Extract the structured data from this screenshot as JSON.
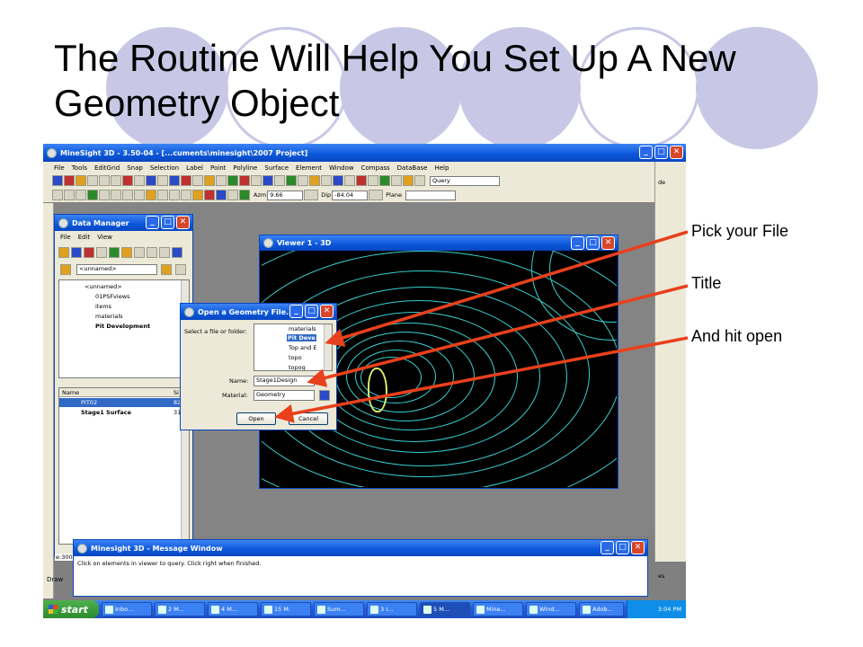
{
  "slide": {
    "title": "The Routine Will Help You Set Up A New Geometry Object",
    "callouts": [
      "Pick your File",
      "Title",
      "And hit open"
    ]
  },
  "app": {
    "title": "MineSight 3D  - 3.50-04 - [...cuments\\minesight\\2007 Project]",
    "menu": [
      "File",
      "Tools",
      "EditGrid",
      "Snap",
      "Selection",
      "Label",
      "Point",
      "Polyline",
      "Surface",
      "Element",
      "Window",
      "Compass",
      "DataBase",
      "Help"
    ],
    "query_label": "Query",
    "azm_label": "Azm",
    "azm_value": "9.66",
    "dip_label": "Dip",
    "dip_value": "-84.04",
    "plane_label": "Plane",
    "side_text": "de",
    "side_text2": "es",
    "draw_label": "Draw"
  },
  "data_manager": {
    "title": "Data Manager",
    "menu": [
      "File",
      "Edit",
      "View"
    ],
    "combo_value": "<unnamed>",
    "tree": [
      "<unnamed>",
      "01PSFviews",
      "items",
      "materials",
      "Pit Development"
    ],
    "columns": [
      "Name",
      "Si"
    ],
    "rows": [
      {
        "name": "PIT02",
        "size": "82"
      },
      {
        "name": "Stage1 Surface",
        "size": "31"
      }
    ],
    "side_text": "e:300"
  },
  "viewer": {
    "title": "Viewer 1 - 3D"
  },
  "dialog": {
    "title": "Open a Geometry File...",
    "select_label": "Select a file or folder:",
    "tree": [
      "materials",
      "Pit Deve",
      "Top and E",
      "topo",
      "topog"
    ],
    "name_label": "Name:",
    "name_value": "Stage1Design",
    "material_label": "Material:",
    "material_value": "Geometry",
    "open_label": "Open",
    "cancel_label": "Cancel"
  },
  "message_window": {
    "title": "Minesight 3D - Message Window",
    "text": "Click on elements in viewer to query.  Click right when finished."
  },
  "taskbar": {
    "start_label": "start",
    "items": [
      "Inbo...",
      "2 M...",
      "4 M...",
      "15 M.",
      "Sum...",
      "3 I...",
      "5 M...",
      "Mine...",
      "Wind...",
      "Adob..."
    ],
    "clock": "3:04 PM"
  },
  "colors": {
    "accent": "#c8c8e6",
    "arrow": "#e8401c",
    "contour": "#3ad0d0",
    "highlight_contour": "#d8f070"
  }
}
